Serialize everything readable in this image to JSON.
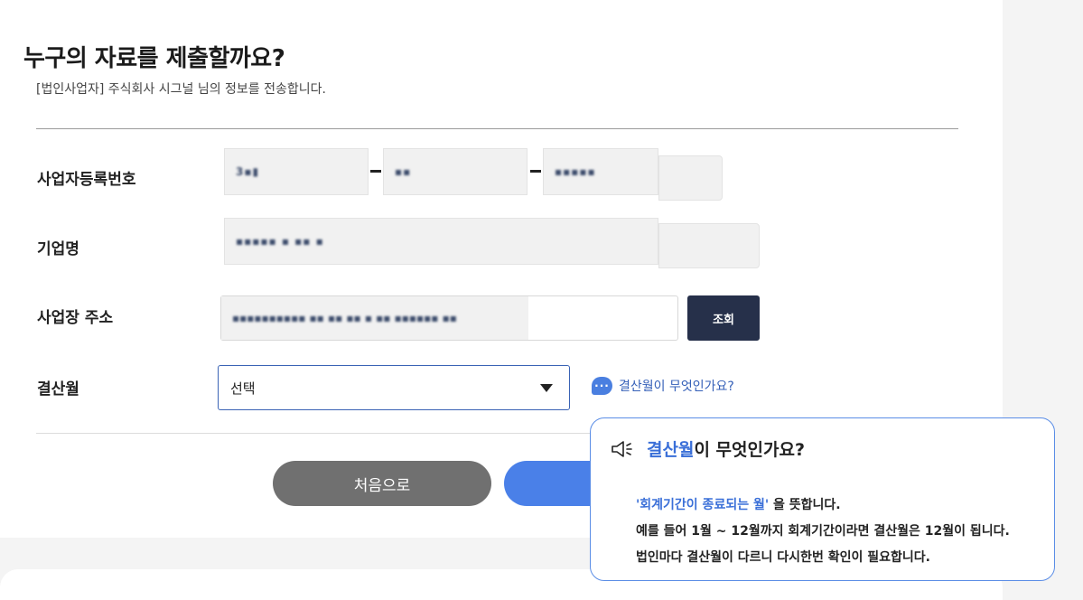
{
  "header": {
    "title": "누구의 자료를 제출할까요?",
    "subtitle": "[법인사업자] 주식회사 시그널 님의 정보를 전송합니다."
  },
  "form": {
    "business_number": {
      "label": "사업자등록번호",
      "part1": "3▪▮",
      "part2": "▪▪",
      "part3": "▪▪▪▪▪"
    },
    "company_name": {
      "label": "기업명",
      "value": "▪▪▪▪▪ ▪ ▪▪ ▪"
    },
    "address": {
      "label": "사업장 주소",
      "value": "▪▪▪▪▪▪▪▪▪▪ ▪▪ ▪▪ ▪▪ ▪ ▪▪ ▪▪▪▪▪▪ ▪▪",
      "search_button": "조회"
    },
    "fiscal_month": {
      "label": "결산월",
      "selected": "선택",
      "help_link": "결산월이 무엇인가요?"
    }
  },
  "actions": {
    "restart_label": "처음으로"
  },
  "tooltip": {
    "title_highlight": "결산월",
    "title_rest": "이 무엇인가요?",
    "line1_highlight": "'회계기간이 종료되는 월'",
    "line1_rest": " 을 뜻합니다.",
    "line2": "예를 들어 1월 ~ 12월까지 회계기간이라면 결산월은 12월이 됩니다.",
    "line3": "법인마다 결산월이 다르니 다시한번 확인이 필요합니다."
  },
  "colors": {
    "primary": "#4a80e8",
    "dark_button": "#26304a",
    "gray_button": "#707070",
    "link": "#3560b8"
  }
}
